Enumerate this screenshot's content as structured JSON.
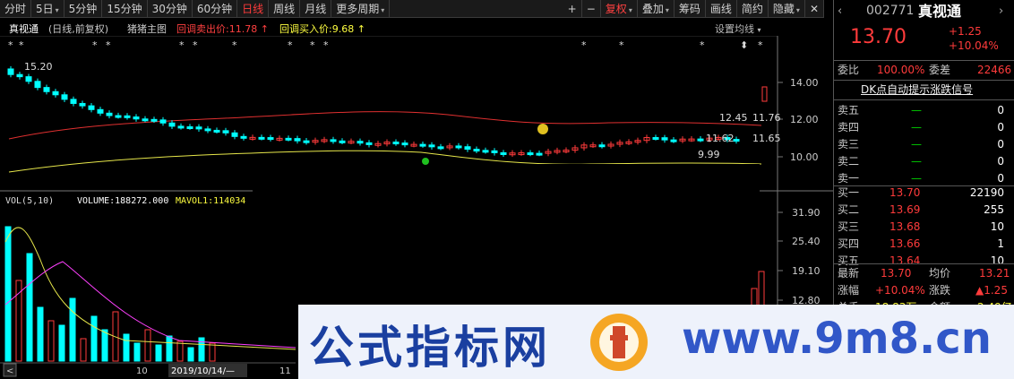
{
  "toolbar": {
    "tabs": [
      {
        "label": "分时",
        "arrow": false,
        "active": false
      },
      {
        "label": "5日",
        "arrow": true,
        "active": false
      },
      {
        "label": "5分钟",
        "arrow": false,
        "active": false
      },
      {
        "label": "15分钟",
        "arrow": false,
        "active": false
      },
      {
        "label": "30分钟",
        "arrow": false,
        "active": false
      },
      {
        "label": "60分钟",
        "arrow": false,
        "active": false
      },
      {
        "label": "日线",
        "arrow": false,
        "active": true
      },
      {
        "label": "周线",
        "arrow": false,
        "active": false
      },
      {
        "label": "月线",
        "arrow": false,
        "active": false
      },
      {
        "label": "更多周期",
        "arrow": true,
        "active": false
      }
    ],
    "tools": [
      {
        "label": "+"
      },
      {
        "label": "−"
      },
      {
        "label": "复权",
        "arrow": true,
        "red": true
      },
      {
        "label": "叠加",
        "arrow": true
      },
      {
        "label": "筹码"
      },
      {
        "label": "画线"
      },
      {
        "label": "简约"
      },
      {
        "label": "隐藏",
        "arrow": true
      }
    ]
  },
  "chart_header": {
    "name": "真视通",
    "mode": "(日线,前复权)",
    "indicator": "猪猪主图",
    "sell_label": "回调卖出价:11.78",
    "buy_label": "回调买入价:9.68",
    "ma_settings": "设置均线"
  },
  "price_axis": [
    "14.00",
    "12.00",
    "10.00"
  ],
  "price_labels": {
    "high": "15.20",
    "low": "9.99",
    "mid_a": "12.45",
    "mid_b": "11.76",
    "mid_c": "11.62",
    "mid_d": "11.65"
  },
  "volume_header": {
    "name": "VOL(5,10)",
    "volume": "VOLUME:188272.000",
    "mavol": "MAVOL1:114034"
  },
  "volume_axis": [
    "31.90",
    "25.40",
    "19.10",
    "12.80"
  ],
  "date_axis": {
    "a": "10",
    "cursor": "2019/10/14/—",
    "b": "11"
  },
  "quote": {
    "code": "002771",
    "name": "真视通",
    "price": "13.70",
    "change": "+1.25",
    "change_pct": "+10.04%",
    "weibi_label": "委比",
    "weibi": "100.00%",
    "weicha_label": "委差",
    "weicha": "22466",
    "dk_link": "DK点自动提示涨跌信号",
    "sells": [
      {
        "label": "卖五",
        "price": "—",
        "vol": "0"
      },
      {
        "label": "卖四",
        "price": "—",
        "vol": "0"
      },
      {
        "label": "卖三",
        "price": "—",
        "vol": "0"
      },
      {
        "label": "卖二",
        "price": "—",
        "vol": "0"
      },
      {
        "label": "卖一",
        "price": "—",
        "vol": "0"
      }
    ],
    "buys": [
      {
        "label": "买一",
        "price": "13.70",
        "vol": "22190"
      },
      {
        "label": "买二",
        "price": "13.69",
        "vol": "255"
      },
      {
        "label": "买三",
        "price": "13.68",
        "vol": "10"
      },
      {
        "label": "买四",
        "price": "13.66",
        "vol": "1"
      },
      {
        "label": "买五",
        "price": "13.64",
        "vol": "10"
      }
    ],
    "stats": {
      "latest_label": "最新",
      "latest": "13.70",
      "avg_label": "均价",
      "avg": "13.21",
      "zf_label": "涨幅",
      "zf": "+10.04%",
      "zd_label": "涨跌",
      "zd": "▲1.25",
      "zs_label": "总手",
      "zs": "18.83万",
      "je_label": "金额",
      "je": "2.49亿"
    }
  },
  "banner": {
    "title": "公式指标网",
    "url": "www.9m8.cn"
  },
  "colors": {
    "up": "#ff3b3b",
    "down": "#00ffff",
    "ma_red": "#e03030",
    "ma_yellow": "#e6e64a",
    "vol_ma_white": "#f0f0f0",
    "vol_ma_yellow": "#e6e64a",
    "vol_ma_magenta": "#ff40ff"
  }
}
